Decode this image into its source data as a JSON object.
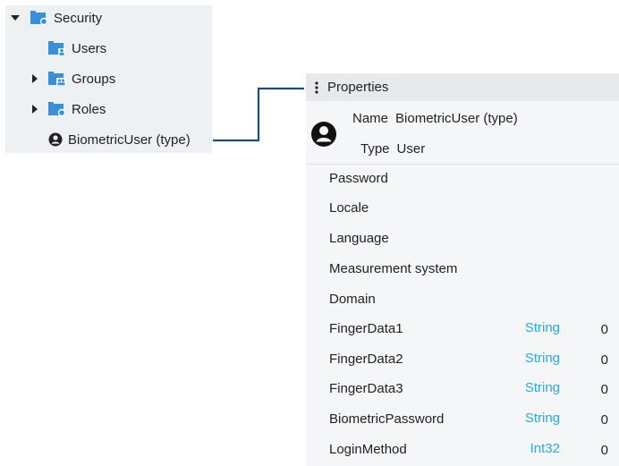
{
  "tree": {
    "items": [
      {
        "label": "Security",
        "caret": "down",
        "icon": "folder-shield-icon"
      },
      {
        "label": "Users",
        "caret": "none",
        "icon": "folder-user-icon"
      },
      {
        "label": "Groups",
        "caret": "right",
        "icon": "folder-group-icon"
      },
      {
        "label": "Roles",
        "caret": "right",
        "icon": "folder-shield-icon"
      },
      {
        "label": "BiometricUser (type)",
        "caret": "none",
        "icon": "user-circle-icon"
      }
    ]
  },
  "panel": {
    "title": "Properties",
    "name_key": "Name",
    "name_value": "BiometricUser (type)",
    "type_key": "Type",
    "type_value": "User",
    "rows": [
      {
        "name": "Password",
        "type": "",
        "value": ""
      },
      {
        "name": "Locale",
        "type": "",
        "value": ""
      },
      {
        "name": "Language",
        "type": "",
        "value": ""
      },
      {
        "name": "Measurement system",
        "type": "",
        "value": ""
      },
      {
        "name": "Domain",
        "type": "",
        "value": ""
      },
      {
        "name": "FingerData1",
        "type": "String",
        "value": "0"
      },
      {
        "name": "FingerData2",
        "type": "String",
        "value": "0"
      },
      {
        "name": "FingerData3",
        "type": "String",
        "value": "0"
      },
      {
        "name": "BiometricPassword",
        "type": "String",
        "value": "0"
      },
      {
        "name": "LoginMethod",
        "type": "Int32",
        "value": "0"
      }
    ]
  },
  "colors": {
    "tree_bg": "#eef1f4",
    "panel_bg": "#f5f6f8",
    "header_bg": "#e7e9ec",
    "folder_blue": "#3a8fd8",
    "type_blue": "#2da8e0",
    "connector": "#1f4e79"
  }
}
